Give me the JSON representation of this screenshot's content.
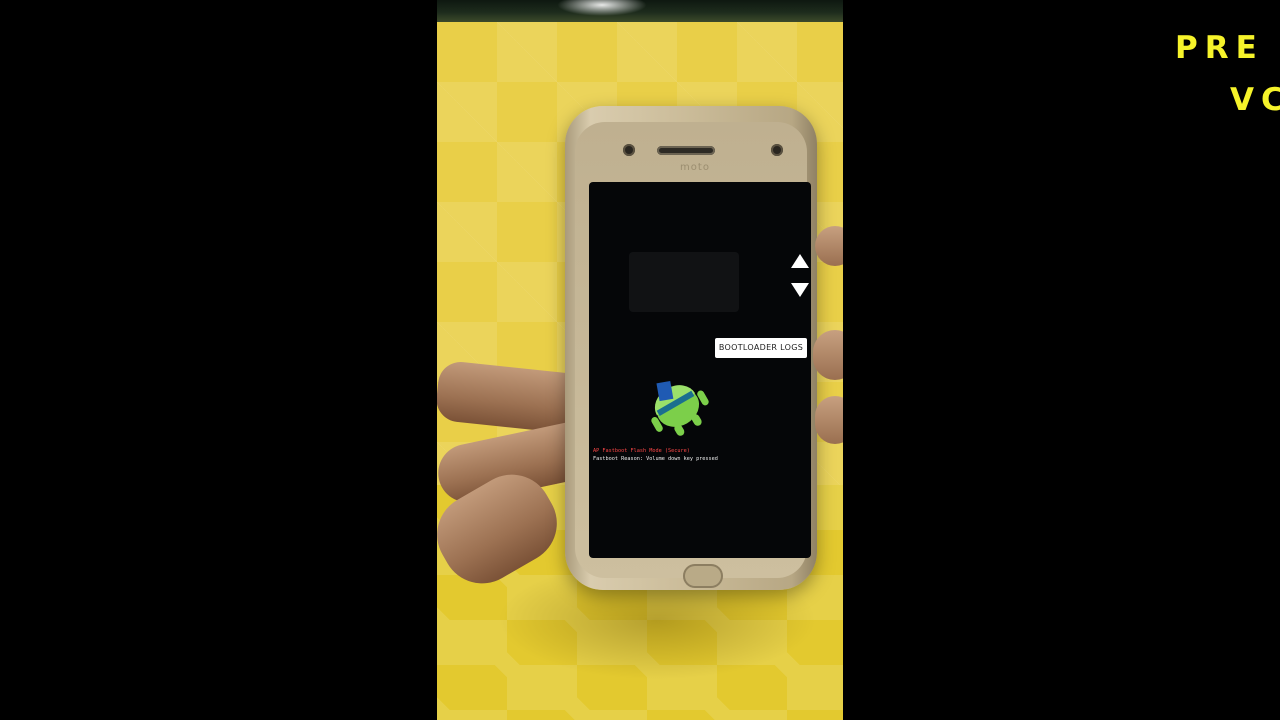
{
  "video": {
    "bootloader_button": "BOOTLOADER LOGS",
    "brand_logo_text": "moto",
    "fastboot_mode_line": "AP Fastboot Flash Mode (Secure)",
    "fastboot_reason_line": "Fastboot Reason: Volume down key pressed",
    "nav_up_icon": "triangle-up",
    "nav_down_icon": "triangle-down"
  },
  "overlay": {
    "line1": "PRE",
    "line2": "VC"
  },
  "colors": {
    "overlay_text": "#f6f32a",
    "screen_bg": "#050608",
    "fastboot_red": "#ff4848",
    "backdrop_yellow": "#e9cf48"
  }
}
